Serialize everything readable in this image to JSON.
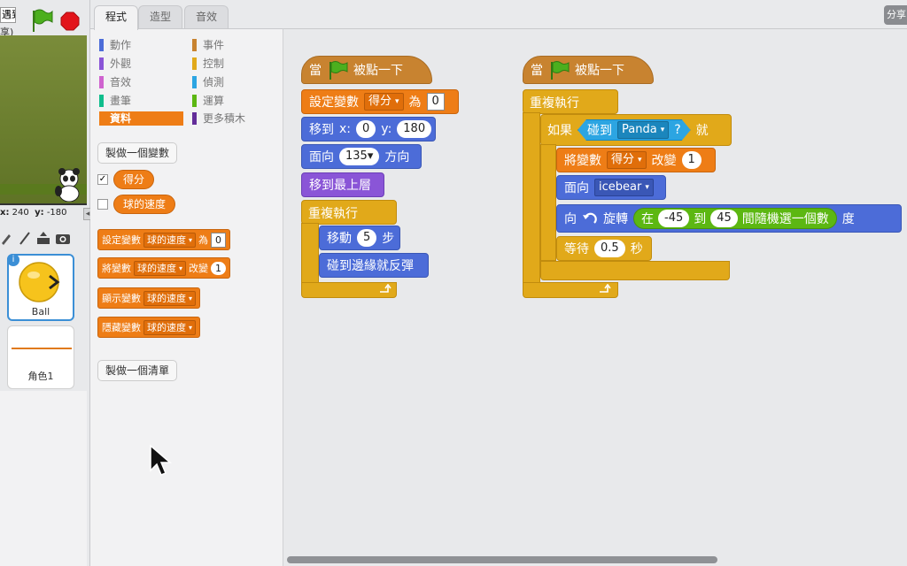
{
  "left": {
    "project_title_fragment": "遇到",
    "project_share_fragment": "享)",
    "coords": {
      "x_label": "x:",
      "x_value": "240",
      "y_label": "y:",
      "y_value": "-180"
    },
    "collapse": "◂",
    "sprites": [
      {
        "name": "Ball"
      },
      {
        "name": "角色1"
      }
    ]
  },
  "tabs": [
    {
      "label": "程式"
    },
    {
      "label": "造型"
    },
    {
      "label": "音效"
    }
  ],
  "share_label": "分享",
  "palette": {
    "categories": [
      {
        "label": "動作",
        "color": "#4c6cd8"
      },
      {
        "label": "事件",
        "color": "#c88330"
      },
      {
        "label": "外觀",
        "color": "#8a55d7"
      },
      {
        "label": "控制",
        "color": "#e1a91a"
      },
      {
        "label": "音效",
        "color": "#cf63cf"
      },
      {
        "label": "偵測",
        "color": "#2ca5e2"
      },
      {
        "label": "畫筆",
        "color": "#0fbd8c"
      },
      {
        "label": "運算",
        "color": "#5cb712"
      },
      {
        "label": "資料",
        "color": "#ee7d16"
      },
      {
        "label": "更多積木",
        "color": "#632d99"
      }
    ],
    "make_variable": "製做一個變數",
    "variables": [
      {
        "name": "得分",
        "checked": "✓"
      },
      {
        "name": "球的速度",
        "checked": ""
      }
    ],
    "blocks": {
      "set_var": {
        "label": "設定變數",
        "var": "球的速度",
        "to": "為",
        "value": "0"
      },
      "change_var": {
        "label": "將變數",
        "var": "球的速度",
        "by": "改變",
        "value": "1"
      },
      "show_var": {
        "label": "顯示變數",
        "var": "球的速度"
      },
      "hide_var": {
        "label": "隱藏變數",
        "var": "球的速度"
      }
    },
    "make_list": "製做一個清單"
  },
  "script1": {
    "hat": {
      "when": "當",
      "clicked": "被點一下"
    },
    "set_var": {
      "label": "設定變數",
      "var": "得分",
      "to": "為",
      "value": "0"
    },
    "goto": {
      "label": "移到",
      "x_label": "x:",
      "x": "0",
      "y_label": "y:",
      "y": "180"
    },
    "point": {
      "label": "面向",
      "dir": "135",
      "suffix": "方向"
    },
    "front": {
      "label": "移到最上層"
    },
    "forever": {
      "label": "重複執行"
    },
    "move": {
      "label": "移動",
      "steps": "5",
      "suffix": "步"
    },
    "bounce": {
      "label": "碰到邊緣就反彈"
    }
  },
  "script2": {
    "hat": {
      "when": "當",
      "clicked": "被點一下"
    },
    "forever": {
      "label": "重複執行"
    },
    "if": {
      "label": "如果",
      "touching": "碰到",
      "target": "Panda",
      "q": "?",
      "then": "就"
    },
    "change_var": {
      "label": "將變數",
      "var": "得分",
      "by": "改變",
      "value": "1"
    },
    "point_towards": {
      "label": "面向",
      "target": "icebear"
    },
    "turn": {
      "label": "向",
      "rot": "旋轉",
      "pick": "在",
      "from": "-45",
      "to_word": "到",
      "to": "45",
      "random": "間隨機選一個數",
      "deg": "度"
    },
    "wait": {
      "label": "等待",
      "secs": "0.5",
      "suffix": "秒"
    }
  }
}
